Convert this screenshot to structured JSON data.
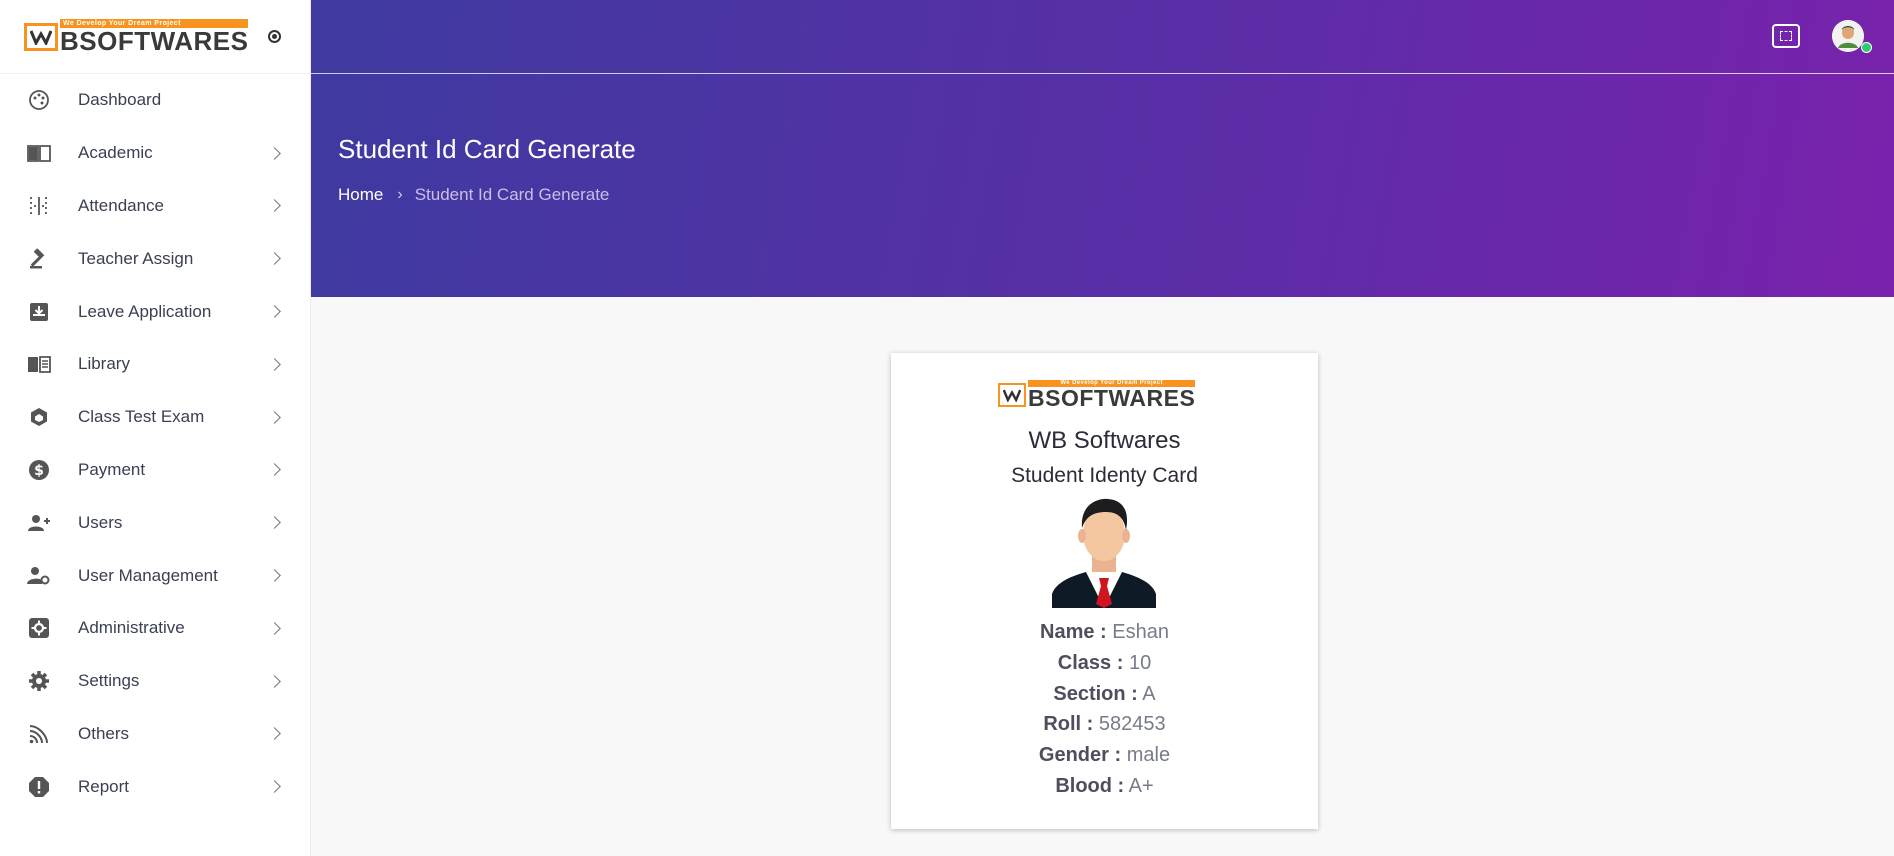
{
  "brand": {
    "tagline": "We Develop Your Dream Project",
    "name": "BSOFTWARES",
    "accent_color": "#f7931e"
  },
  "sidebar": {
    "items": [
      {
        "label": "Dashboard",
        "icon": "palette-icon",
        "has_children": false
      },
      {
        "label": "Academic",
        "icon": "book-icon",
        "has_children": true
      },
      {
        "label": "Attendance",
        "icon": "grid-dots-icon",
        "has_children": true
      },
      {
        "label": "Teacher Assign",
        "icon": "gavel-icon",
        "has_children": true
      },
      {
        "label": "Leave Application",
        "icon": "inbox-download-icon",
        "has_children": true
      },
      {
        "label": "Library",
        "icon": "library-book-icon",
        "has_children": true
      },
      {
        "label": "Class Test Exam",
        "icon": "cube-icon",
        "has_children": true
      },
      {
        "label": "Payment",
        "icon": "dollar-circle-icon",
        "has_children": true
      },
      {
        "label": "Users",
        "icon": "users-add-icon",
        "has_children": true
      },
      {
        "label": "User Management",
        "icon": "user-settings-icon",
        "has_children": true
      },
      {
        "label": "Administrative",
        "icon": "admin-cog-icon",
        "has_children": true
      },
      {
        "label": "Settings",
        "icon": "gear-icon",
        "has_children": true
      },
      {
        "label": "Others",
        "icon": "signal-icon",
        "has_children": true
      },
      {
        "label": "Report",
        "icon": "alert-octagon-icon",
        "has_children": true
      }
    ]
  },
  "header": {
    "page_title": "Student Id Card Generate",
    "breadcrumb": {
      "home": "Home",
      "separator": "›",
      "current": "Student Id Card Generate"
    },
    "gradient_start": "#3e3aa0",
    "gradient_end": "#7a22ad"
  },
  "card": {
    "school_name": "WB Softwares",
    "title": "Student Identy Card",
    "fields": [
      {
        "label": "Name :",
        "value": "Eshan"
      },
      {
        "label": "Class :",
        "value": "10"
      },
      {
        "label": "Section :",
        "value": "A"
      },
      {
        "label": "Roll :",
        "value": "582453"
      },
      {
        "label": "Gender :",
        "value": "male"
      },
      {
        "label": "Blood :",
        "value": "A+"
      }
    ]
  }
}
